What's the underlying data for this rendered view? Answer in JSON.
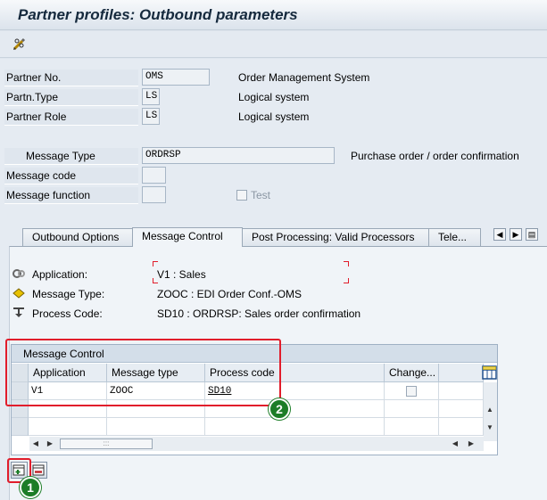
{
  "title": "Partner profiles: Outbound parameters",
  "toolbar": {
    "edit_icon": "pencil-glasses-icon"
  },
  "header_fields": {
    "partner_no": {
      "label": "Partner No.",
      "value": "OMS",
      "desc": "Order Management System"
    },
    "partn_type": {
      "label": "Partn.Type",
      "value": "LS",
      "desc": "Logical system"
    },
    "partner_role": {
      "label": "Partner Role",
      "value": "LS",
      "desc": "Logical system"
    },
    "message_type": {
      "label": "Message Type",
      "value": "ORDRSP",
      "desc": "Purchase order / order confirmation"
    },
    "message_code": {
      "label": "Message code",
      "value": ""
    },
    "message_function": {
      "label": "Message function",
      "value": ""
    },
    "test": {
      "label": "Test",
      "checked": false
    }
  },
  "tabs": [
    {
      "label": "Outbound Options",
      "active": false
    },
    {
      "label": "Message Control",
      "active": true
    },
    {
      "label": "Post Processing: Valid Processors",
      "active": false
    },
    {
      "label": "Tele...",
      "active": false
    }
  ],
  "info": {
    "application": {
      "label": "Application:",
      "value": "V1 : Sales"
    },
    "message_type": {
      "label": "Message Type:",
      "value": "ZOOC : EDI Order Conf.-OMS"
    },
    "process_code": {
      "label": "Process Code:",
      "value": "SD10 : ORDRSP: Sales order confirmation"
    }
  },
  "table": {
    "title": "Message Control",
    "columns": [
      "Application",
      "Message type",
      "Process code",
      "Change..."
    ],
    "rows": [
      {
        "application": "V1",
        "message_type": "ZOOC",
        "process_code": "SD10",
        "change": false
      }
    ]
  },
  "annotations": {
    "badge1": "1",
    "badge2": "2",
    "highlight_color": "#e11d2b",
    "badge_color": "#1c7d27"
  }
}
